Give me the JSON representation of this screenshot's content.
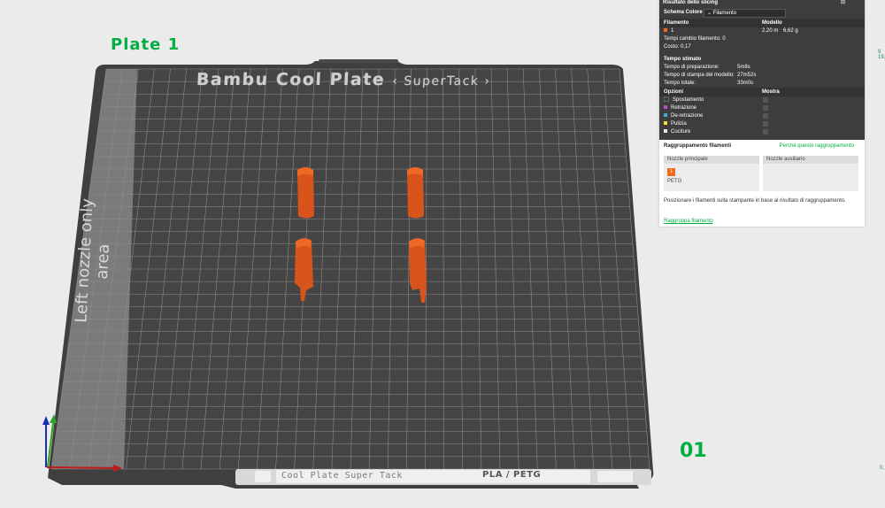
{
  "plate": {
    "name": "Plate 1",
    "number": "01",
    "bed_title": "Bambu Cool Plate",
    "bed_subtitle": "‹ SuperTack ›",
    "left_area_label": "Left nozzle only area",
    "bottom_label": "Cool Plate Super Tack",
    "bottom_materials": "PLA / PETG"
  },
  "colors": {
    "accent": "#00ae42",
    "filament": "#f26b1d",
    "bed": "#3b3b3b"
  },
  "panel": {
    "title": "Risultato dello slicing",
    "scheme_label": "Schema Colore",
    "scheme_value": "Filamento",
    "filament_header": "Filamento",
    "model_header": "Modello",
    "filament_id": "1",
    "filament_length": "2,20 m",
    "filament_weight": "6,62 g",
    "change_time_label": "Tempi cambio filamento:",
    "change_time_value": "0",
    "cost_label": "Costo:",
    "cost_value": "0,17",
    "time_header": "Tempo stimato",
    "prep_label": "Tempo di preparazione:",
    "prep_value": "5m8s",
    "model_time_label": "Tempo di stampa del modello:",
    "model_time_value": "27m52s",
    "total_label": "Tempo totale:",
    "total_value": "33m0s",
    "options_header": "Opzioni",
    "show_header": "Mostra",
    "options": [
      {
        "label": "Spostamento",
        "color": "#3d3d3d"
      },
      {
        "label": "Retrazione",
        "color": "#c548c5"
      },
      {
        "label": "De-retrazione",
        "color": "#4aa3df"
      },
      {
        "label": "Pulizia",
        "color": "#f2e02e"
      },
      {
        "label": "Cuciture",
        "color": "#e6e6e6"
      }
    ],
    "group_title": "Raggruppamento filamenti",
    "group_link": "Perché questo raggruppamento",
    "nozzle_main": "Nozzle principale",
    "nozzle_aux": "Nozzle ausiliario",
    "chip_label": "1",
    "chip_material": "PETG",
    "note": "Posizionare i filamenti sulla stampante in base al risultato di raggruppamento.",
    "regroup_link": "Raggruppa filamento"
  },
  "edge": {
    "top_label": "9\n19,",
    "bottom_label": "0,"
  },
  "icons": [
    "plate-settings-icon",
    "lock-icon",
    "axis-icon",
    "pin-icon"
  ]
}
